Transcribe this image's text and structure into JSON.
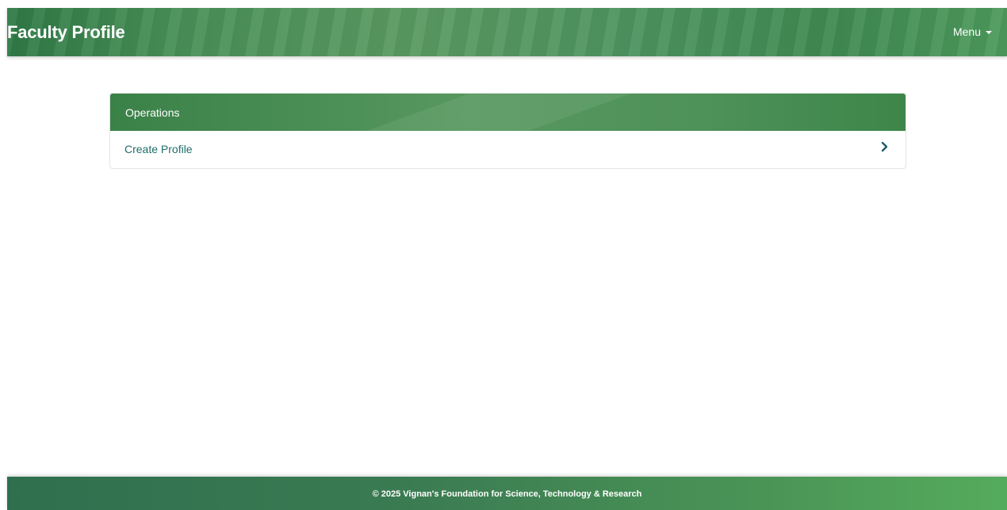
{
  "header": {
    "title": "Faculty Profile",
    "menu_label": "Menu",
    "menu_icon": "caret-down-icon"
  },
  "operations_card": {
    "title": "Operations",
    "items": [
      {
        "label": "Create Profile",
        "icon": "chevron-right-icon"
      }
    ]
  },
  "footer": {
    "copyright": "© 2025 Vignan's Foundation for Science, Technology & Research"
  },
  "colors": {
    "brand_green": "#4a9058",
    "link_teal": "#1f6f6a",
    "chevron": "#1d5d6b"
  }
}
